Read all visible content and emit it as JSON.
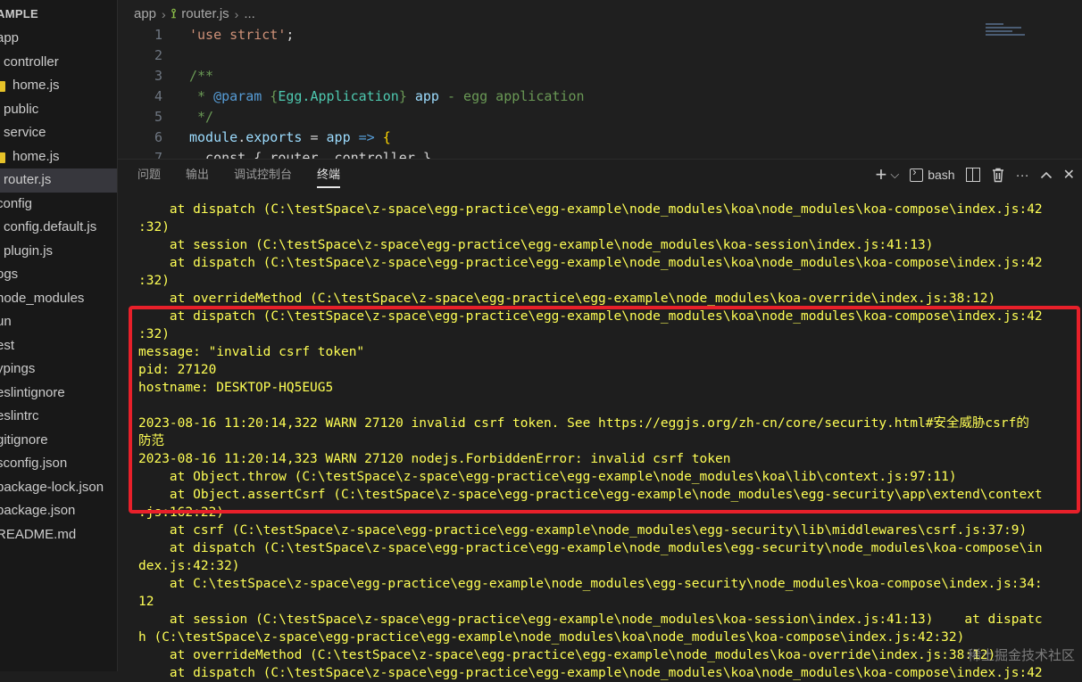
{
  "sidebar": {
    "header": "AMPLE",
    "items": [
      {
        "label": "app",
        "indent": 0,
        "icon": "none"
      },
      {
        "label": "controller",
        "indent": 1,
        "icon": "none"
      },
      {
        "label": "home.js",
        "indent": 2,
        "icon": "js"
      },
      {
        "label": "public",
        "indent": 1,
        "icon": "none"
      },
      {
        "label": "service",
        "indent": 1,
        "icon": "none"
      },
      {
        "label": "home.js",
        "indent": 2,
        "icon": "js"
      },
      {
        "label": "router.js",
        "indent": 1,
        "icon": "none",
        "active": true
      },
      {
        "label": "config",
        "indent": 0,
        "icon": "none"
      },
      {
        "label": "config.default.js",
        "indent": 1,
        "icon": "none"
      },
      {
        "label": "plugin.js",
        "indent": 1,
        "icon": "none"
      },
      {
        "label": "ogs",
        "indent": 0,
        "icon": "none"
      },
      {
        "label": "node_modules",
        "indent": 0,
        "icon": "none"
      },
      {
        "label": "un",
        "indent": 0,
        "icon": "none"
      },
      {
        "label": "est",
        "indent": 0,
        "icon": "none"
      },
      {
        "label": "ypings",
        "indent": 0,
        "icon": "none"
      },
      {
        "label": "eslintignore",
        "indent": 0,
        "icon": "none"
      },
      {
        "label": "eslintrc",
        "indent": 0,
        "icon": "none"
      },
      {
        "label": "gitignore",
        "indent": 0,
        "icon": "none"
      },
      {
        "label": "sconfig.json",
        "indent": 0,
        "icon": "none"
      },
      {
        "label": "package-lock.json",
        "indent": 0,
        "icon": "none"
      },
      {
        "label": "package.json",
        "indent": 0,
        "icon": "none"
      },
      {
        "label": "README.md",
        "indent": 0,
        "icon": "none"
      }
    ]
  },
  "editor": {
    "breadcrumb": {
      "folder": "app",
      "file": "router.js",
      "more": "..."
    },
    "lines": [
      {
        "num": "1",
        "parts": [
          {
            "t": "'use strict'",
            "c": "str"
          },
          {
            "t": ";",
            "c": "op"
          }
        ]
      },
      {
        "num": "2",
        "parts": []
      },
      {
        "num": "3",
        "parts": [
          {
            "t": "/**",
            "c": "cm"
          }
        ]
      },
      {
        "num": "4",
        "parts": [
          {
            "t": " * ",
            "c": "cm"
          },
          {
            "t": "@param",
            "c": "cm-kw"
          },
          {
            "t": " {",
            "c": "cm"
          },
          {
            "t": "Egg.Application",
            "c": "cm-type"
          },
          {
            "t": "} ",
            "c": "cm"
          },
          {
            "t": "app",
            "c": "cm-var"
          },
          {
            "t": " - egg application",
            "c": "cm"
          }
        ]
      },
      {
        "num": "5",
        "parts": [
          {
            "t": " */",
            "c": "cm"
          }
        ]
      },
      {
        "num": "6",
        "parts": [
          {
            "t": "module",
            "c": "cm-var"
          },
          {
            "t": ".",
            "c": "op"
          },
          {
            "t": "exports",
            "c": "cm-var"
          },
          {
            "t": " = ",
            "c": "op"
          },
          {
            "t": "app",
            "c": "cm-var"
          },
          {
            "t": " => ",
            "c": "kw"
          },
          {
            "t": "{",
            "c": "pn"
          }
        ]
      },
      {
        "num": "7",
        "parts": [
          {
            "t": "  const { router, controller }",
            "c": "op"
          }
        ]
      }
    ]
  },
  "panel": {
    "tabs": [
      {
        "label": "问题",
        "active": false
      },
      {
        "label": "输出",
        "active": false
      },
      {
        "label": "调试控制台",
        "active": false
      },
      {
        "label": "终端",
        "active": true
      }
    ],
    "tools": {
      "add": "+",
      "dropdown": "⌵",
      "shell": "bash",
      "more": "···",
      "up": "⌃",
      "close": "✕"
    }
  },
  "terminal": {
    "lines": [
      "    at dispatch (C:\\testSpace\\z-space\\egg-practice\\egg-example\\node_modules\\koa\\node_modules\\koa-compose\\index.js:42",
      ":32)",
      "    at session (C:\\testSpace\\z-space\\egg-practice\\egg-example\\node_modules\\koa-session\\index.js:41:13)",
      "    at dispatch (C:\\testSpace\\z-space\\egg-practice\\egg-example\\node_modules\\koa\\node_modules\\koa-compose\\index.js:42",
      ":32)",
      "    at overrideMethod (C:\\testSpace\\z-space\\egg-practice\\egg-example\\node_modules\\koa-override\\index.js:38:12)",
      "    at dispatch (C:\\testSpace\\z-space\\egg-practice\\egg-example\\node_modules\\koa\\node_modules\\koa-compose\\index.js:42",
      ":32)",
      "message: \"invalid csrf token\"",
      "pid: 27120",
      "hostname: DESKTOP-HQ5EUG5",
      "",
      "2023-08-16 11:20:14,322 WARN 27120 invalid csrf token. See https://eggjs.org/zh-cn/core/security.html#安全威胁csrf的",
      "防范",
      "2023-08-16 11:20:14,323 WARN 27120 nodejs.ForbiddenError: invalid csrf token",
      "    at Object.throw (C:\\testSpace\\z-space\\egg-practice\\egg-example\\node_modules\\koa\\lib\\context.js:97:11)",
      "    at Object.assertCsrf (C:\\testSpace\\z-space\\egg-practice\\egg-example\\node_modules\\egg-security\\app\\extend\\context",
      ".js:162:22)",
      "    at csrf (C:\\testSpace\\z-space\\egg-practice\\egg-example\\node_modules\\egg-security\\lib\\middlewares\\csrf.js:37:9)",
      "    at dispatch (C:\\testSpace\\z-space\\egg-practice\\egg-example\\node_modules\\egg-security\\node_modules\\koa-compose\\in",
      "dex.js:42:32)",
      "    at C:\\testSpace\\z-space\\egg-practice\\egg-example\\node_modules\\egg-security\\node_modules\\koa-compose\\index.js:34:",
      "12",
      "    at session (C:\\testSpace\\z-space\\egg-practice\\egg-example\\node_modules\\koa-session\\index.js:41:13)    at dispatc",
      "h (C:\\testSpace\\z-space\\egg-practice\\egg-example\\node_modules\\koa\\node_modules\\koa-compose\\index.js:42:32)",
      "    at overrideMethod (C:\\testSpace\\z-space\\egg-practice\\egg-example\\node_modules\\koa-override\\index.js:38:12)",
      "    at dispatch (C:\\testSpace\\z-space\\egg-practice\\egg-example\\node_modules\\koa\\node_modules\\koa-compose\\index.js:42"
    ]
  },
  "watermark": "稀土掘金技术社区",
  "colors": {
    "terminal_text": "#ffff55",
    "highlight_border": "#e8202a",
    "accent": "#007acc"
  }
}
